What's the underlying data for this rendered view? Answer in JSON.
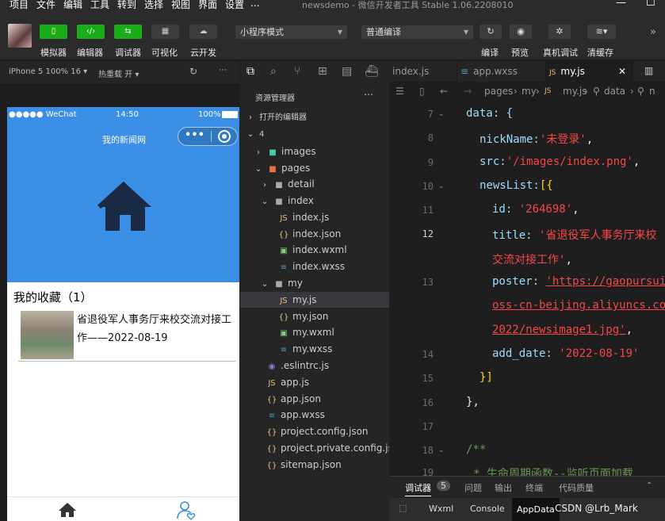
{
  "menubar": {
    "items": [
      "项目",
      "文件",
      "编辑",
      "工具",
      "转到",
      "选择",
      "视图",
      "界面",
      "设置",
      "..."
    ],
    "title": "newsdemo - 微信开发者工具 Stable 1.06.2208010"
  },
  "toolbar": {
    "simulator_label": "模拟器",
    "editor_label": "编辑器",
    "debugger_label": "调试器",
    "visual_label": "可视化",
    "cloud_label": "云开发",
    "mode_select": "小程序模式",
    "compile_select": "普通编译",
    "compile_label": "编译",
    "preview_label": "预览",
    "realdebug_label": "真机调试",
    "clearcache_label": "清缓存"
  },
  "simulator": {
    "device": "iPhone 5 100% 16 ▾",
    "hotreload": "热重载 开 ▾",
    "statusbar": {
      "carrier": "●●●●● WeChat",
      "time": "14:50",
      "battery": "100%"
    },
    "nav_title": "我的新闻网",
    "favorites_title": "我的收藏（1）",
    "fav_item_text": "省退役军人事务厅来校交流对接工作——2022-08-19"
  },
  "explorer": {
    "header": "资源管理器",
    "open_editors": "打开的编辑器",
    "root": "4",
    "items": [
      {
        "label": "images"
      },
      {
        "label": "pages"
      },
      {
        "label": "detail"
      },
      {
        "label": "index"
      },
      {
        "label": "index.js"
      },
      {
        "label": "index.json"
      },
      {
        "label": "index.wxml"
      },
      {
        "label": "index.wxss"
      },
      {
        "label": "my"
      },
      {
        "label": "my.js"
      },
      {
        "label": "my.json"
      },
      {
        "label": "my.wxml"
      },
      {
        "label": "my.wxss"
      },
      {
        "label": ".eslintrc.js"
      },
      {
        "label": "app.js"
      },
      {
        "label": "app.json"
      },
      {
        "label": "app.wxss"
      },
      {
        "label": "project.config.json"
      },
      {
        "label": "project.private.config.js..."
      },
      {
        "label": "sitemap.json"
      }
    ]
  },
  "editor": {
    "tabs": [
      "index.js",
      "app.wxss",
      "my.js"
    ],
    "breadcrumb": [
      "pages",
      "my",
      "my.js",
      "data",
      "n"
    ],
    "line_numbers": [
      "7",
      "8",
      "9",
      "10",
      "11",
      "12",
      "13",
      "14",
      "15",
      "16",
      "17",
      "18",
      "19"
    ],
    "code": {
      "l7": "data: {",
      "l8a": "nickName:",
      "l8b": "'未登录'",
      "l9a": "src:",
      "l9b": "'/images/index.png'",
      "l10a": "newsList:",
      "l11a": "id: ",
      "l11b": "'264698'",
      "l12a": "title: ",
      "l12b": "'省退役军人事务厅来校",
      "l12c": "交流对接工作'",
      "l13a": "poster: ",
      "l13b": "'https://gaopursui",
      "l13c": "oss-cn-beijing.aliyuncs.co",
      "l13d": "2022/newsimage1.jpg'",
      "l14a": "add_date: ",
      "l14b": "'2022-08-19'",
      "l16": "},",
      "l18": "/**",
      "l19": "* 生命周期函数--监听页面加载"
    }
  },
  "panel": {
    "tabs": [
      "调试器",
      "5",
      "问题",
      "输出",
      "终端",
      "代码质量"
    ],
    "subtabs": [
      "Wxml",
      "Console",
      "AppData"
    ],
    "watermark": "CSDN @Lrb_Mark"
  },
  "colors": {
    "accent_green": "#1aad19",
    "phone_blue": "#3a8ee6"
  }
}
